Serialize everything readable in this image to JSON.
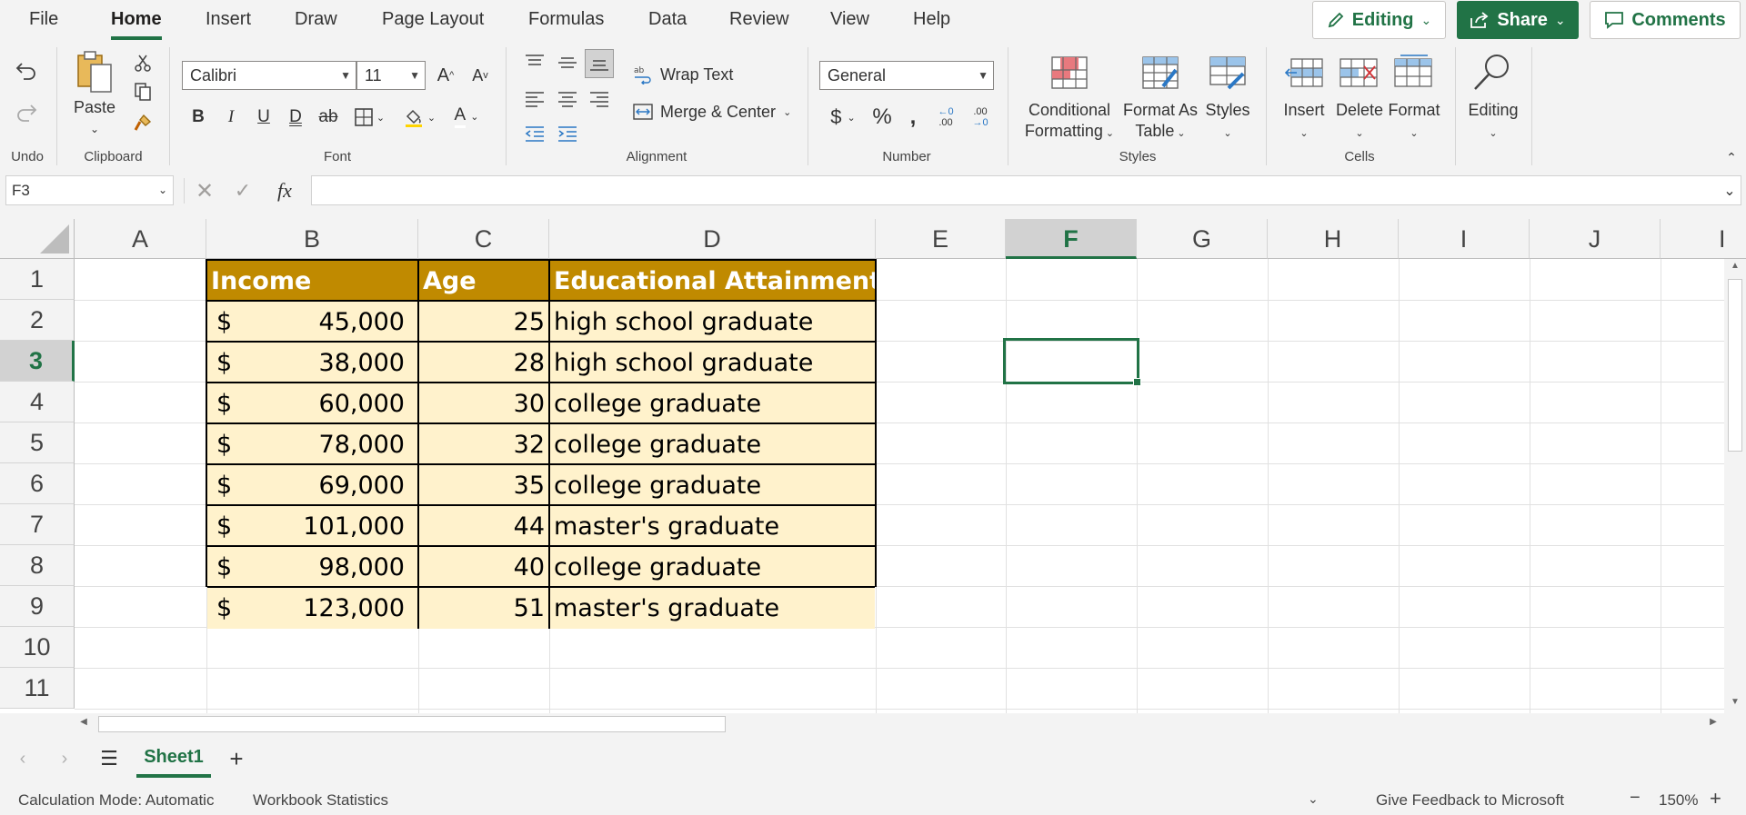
{
  "menu": {
    "tabs": [
      "File",
      "Home",
      "Insert",
      "Draw",
      "Page Layout",
      "Formulas",
      "Data",
      "Review",
      "View",
      "Help"
    ],
    "active": "Home"
  },
  "top_buttons": {
    "editing": "Editing",
    "share": "Share",
    "comments": "Comments"
  },
  "ribbon": {
    "undo": {
      "label": "Undo"
    },
    "clipboard": {
      "label": "Clipboard",
      "paste": "Paste"
    },
    "font": {
      "label": "Font",
      "font_name": "Calibri",
      "font_size": "11"
    },
    "alignment": {
      "label": "Alignment",
      "wrap_text": "Wrap Text",
      "merge_center": "Merge & Center"
    },
    "number": {
      "label": "Number",
      "format": "General"
    },
    "styles": {
      "label": "Styles",
      "conditional_1": "Conditional",
      "conditional_2": "Formatting",
      "format_as_1": "Format As",
      "format_as_2": "Table",
      "styles": "Styles"
    },
    "cells": {
      "label": "Cells",
      "insert": "Insert",
      "delete": "Delete",
      "format": "Format"
    },
    "editing": {
      "label": "Editing"
    }
  },
  "formula_bar": {
    "name_box": "F3",
    "fx": "fx",
    "value": ""
  },
  "columns": [
    "A",
    "B",
    "C",
    "D",
    "E",
    "F",
    "G",
    "H",
    "I",
    "J",
    "I"
  ],
  "rows": [
    "1",
    "2",
    "3",
    "4",
    "5",
    "6",
    "7",
    "8",
    "9",
    "10",
    "11"
  ],
  "selected": {
    "column": "F",
    "row": "3"
  },
  "table": {
    "headers": [
      "Income",
      "Age",
      "Educational Attainment"
    ],
    "currency_symbol": "$",
    "rows": [
      {
        "income": "45,000",
        "age": "25",
        "education": "high school graduate"
      },
      {
        "income": "38,000",
        "age": "28",
        "education": "high school graduate"
      },
      {
        "income": "60,000",
        "age": "30",
        "education": "college graduate"
      },
      {
        "income": "78,000",
        "age": "32",
        "education": "college graduate"
      },
      {
        "income": "69,000",
        "age": "35",
        "education": "college graduate"
      },
      {
        "income": "101,000",
        "age": "44",
        "education": "master's graduate"
      },
      {
        "income": "98,000",
        "age": "40",
        "education": "college graduate"
      },
      {
        "income": "123,000",
        "age": "51",
        "education": "master's graduate"
      }
    ]
  },
  "sheets": {
    "active": "Sheet1"
  },
  "status": {
    "calc_mode": "Calculation Mode: Automatic",
    "stats": "Workbook Statistics",
    "feedback": "Give Feedback to Microsoft",
    "zoom": "150%"
  },
  "colors": {
    "accent": "#217346",
    "header_fill": "#c08a00",
    "data_fill": "#fff2cc"
  }
}
